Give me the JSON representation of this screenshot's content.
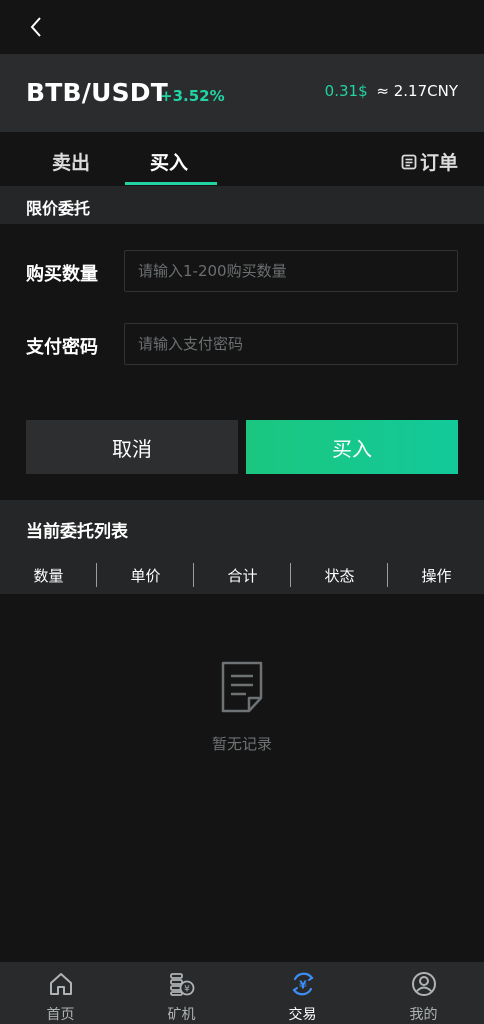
{
  "header": {
    "pair": "BTB/USDT",
    "change": "+3.52%",
    "price_usd": "0.31$",
    "price_cny": "≈ 2.17CNY"
  },
  "tabs": {
    "sell": "卖出",
    "buy": "买入",
    "orders": "订单"
  },
  "form": {
    "section_title": "限价委托",
    "quantity_label": "购买数量",
    "quantity_placeholder": "请输入1-200购买数量",
    "quantity_value": "",
    "password_label": "支付密码",
    "password_placeholder": "请输入支付密码",
    "password_value": "",
    "cancel_label": "取消",
    "buy_label": "买入"
  },
  "orders_list": {
    "title": "当前委托列表",
    "columns": [
      "数量",
      "单价",
      "合计",
      "状态",
      "操作"
    ],
    "empty_text": "暂无记录"
  },
  "bottom_nav": [
    {
      "label": "首页",
      "icon": "home-icon"
    },
    {
      "label": "矿机",
      "icon": "coins-icon"
    },
    {
      "label": "交易",
      "icon": "exchange-icon",
      "active": true
    },
    {
      "label": "我的",
      "icon": "user-icon"
    }
  ],
  "colors": {
    "accent": "#22d3a4",
    "active_nav": "#3d8df5",
    "background": "#141414"
  }
}
